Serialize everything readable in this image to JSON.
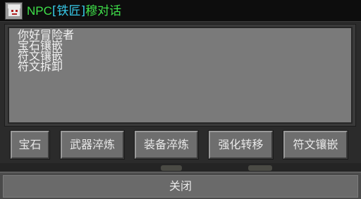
{
  "title": {
    "npc": "NPC",
    "role": "[铁匠]",
    "name": "穆对话"
  },
  "avatar_icon": "npc-portrait-icon",
  "dialog": {
    "options": [
      "你好冒险者",
      "宝石镶嵌",
      "符文镶嵌",
      "符文拆卸"
    ]
  },
  "tabs": [
    "宝石",
    "武器淬炼",
    "装备淬炼",
    "强化转移",
    "符文镶嵌"
  ],
  "close_label": "关闭",
  "colors": {
    "npc_tag": "#3fe04a",
    "role_tag": "#37c9e8",
    "panel_bg": "#7a7a7a"
  }
}
